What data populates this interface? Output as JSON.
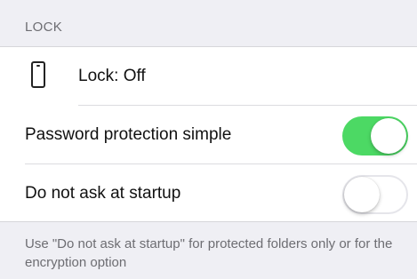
{
  "section": {
    "title": "LOCK"
  },
  "rows": {
    "lock": {
      "label": "Lock: Off",
      "icon": "phone-icon"
    },
    "password_simple": {
      "label": "Password protection simple",
      "toggle_on": true
    },
    "no_ask_startup": {
      "label": "Do not ask at startup",
      "toggle_on": false
    }
  },
  "footer": {
    "note": "Use \"Do not ask at startup\" for protected folders only or for the encryption option"
  },
  "colors": {
    "toggle_on": "#4cd964",
    "background": "#efeff4",
    "secondary_text": "#6d6d72"
  }
}
